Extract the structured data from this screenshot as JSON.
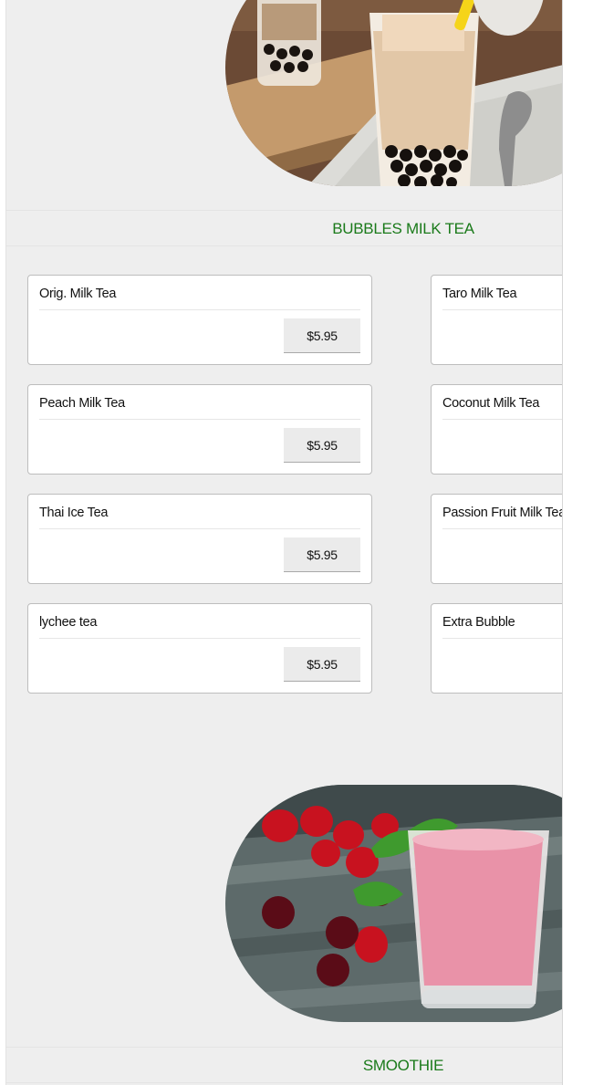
{
  "sections": [
    {
      "title": "BUBBLES MILK TEA",
      "image": "bubble-milk-tea-photo",
      "items": [
        {
          "name": "Orig. Milk Tea",
          "price": "$5.95"
        },
        {
          "name": "Taro Milk Tea",
          "price": ""
        },
        {
          "name": "Peach Milk Tea",
          "price": "$5.95"
        },
        {
          "name": "Coconut Milk Tea",
          "price": ""
        },
        {
          "name": "Thai Ice Tea",
          "price": "$5.95"
        },
        {
          "name": "Passion Fruit Milk Tea",
          "price": ""
        },
        {
          "name": "lychee tea",
          "price": "$5.95"
        },
        {
          "name": "Extra Bubble",
          "price": ""
        }
      ]
    },
    {
      "title": "SMOOTHIE",
      "image": "strawberry-smoothie-photo"
    }
  ],
  "colors": {
    "section_title": "#1a7a1a",
    "page_background": "#eeeeee",
    "card_background": "#ffffff",
    "price_button": "#ebebeb"
  }
}
